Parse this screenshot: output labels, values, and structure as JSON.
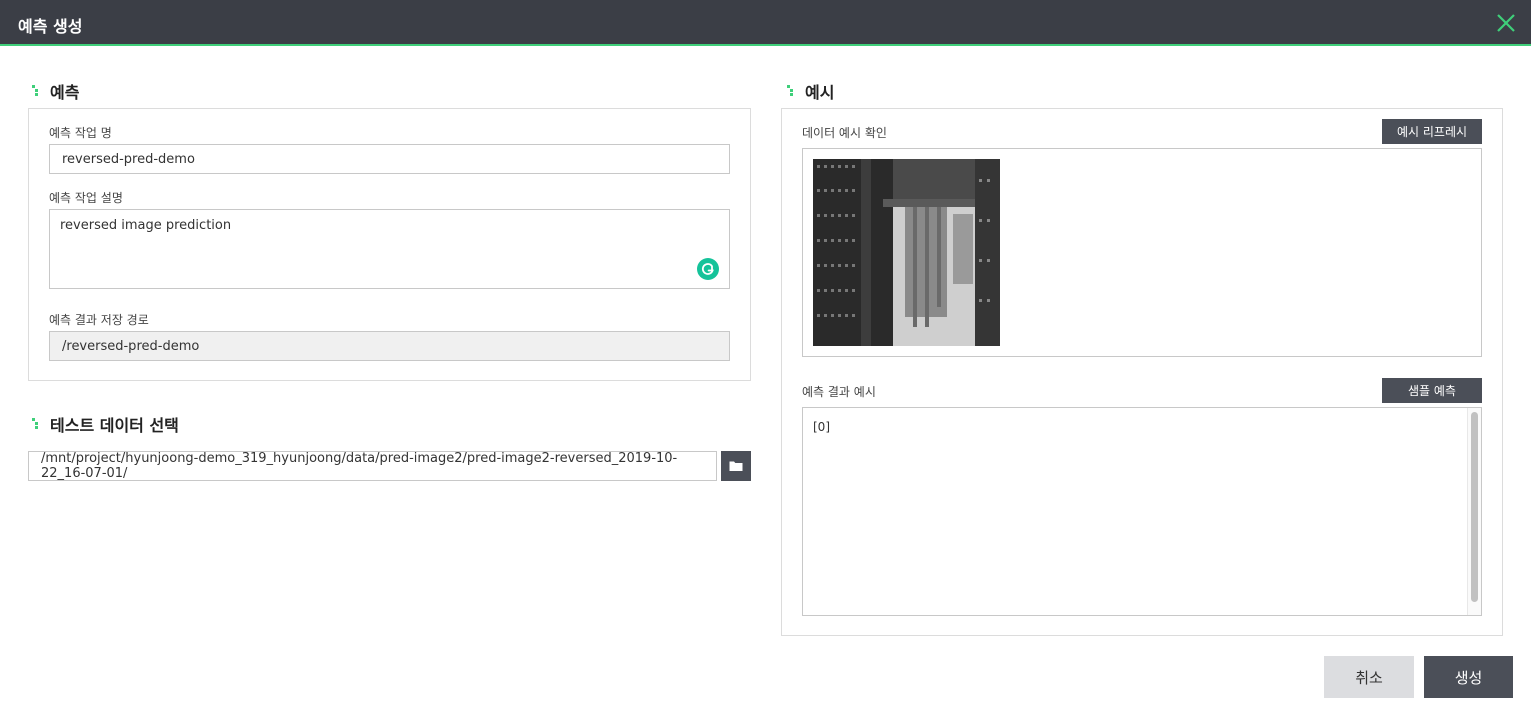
{
  "dialog": {
    "title": "예측 생성"
  },
  "prediction": {
    "section_title": "예측",
    "job_name_label": "예측 작업 명",
    "job_name_value": "reversed-pred-demo",
    "job_desc_label": "예측 작업 설명",
    "job_desc_value": "reversed image prediction",
    "result_path_label": "예측 결과 저장 경로",
    "result_path_value": "/reversed-pred-demo"
  },
  "test_data": {
    "section_title": "테스트 데이터 선택",
    "path_value": "/mnt/project/hyunjoong-demo_319_hyunjoong/data/pred-image2/pred-image2-reversed_2019-10-22_16-07-01/"
  },
  "example": {
    "section_title": "예시",
    "data_example_label": "데이터 예시 확인",
    "refresh_button": "예시 리프레시",
    "result_example_label": "예측 결과 예시",
    "sample_predict_button": "샘플 예측",
    "result_text": "[0]"
  },
  "footer": {
    "cancel_label": "취소",
    "create_label": "생성"
  },
  "colors": {
    "accent": "#3fcf7a",
    "header_bg": "#3b3e46",
    "dark_button": "#4b4f58"
  },
  "icons": [
    "close-icon",
    "folder-icon",
    "grammarly-icon",
    "section-marker-icon"
  ]
}
